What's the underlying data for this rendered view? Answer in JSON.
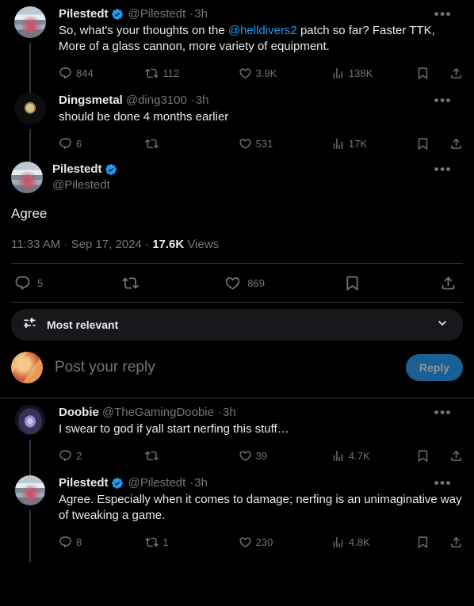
{
  "thread": {
    "posts": [
      {
        "id": "post-1",
        "display_name": "Pilestedt",
        "verified": true,
        "handle": "@Pilestedt",
        "separator": "·",
        "time": "3h",
        "text_before": "So, what's your thoughts on the ",
        "mention": "@helldivers2",
        "text_after": " patch so far? Faster TTK, More of a glass cannon, more variety of equipment.",
        "replies": "844",
        "reposts": "112",
        "likes": "3.9K",
        "views": "138K",
        "avatar_class": "av-pilestedt"
      },
      {
        "id": "post-2",
        "display_name": "Dingsmetal",
        "verified": false,
        "handle": "@ding3100",
        "separator": "·",
        "time": "3h",
        "text": "should be done 4 months earlier",
        "replies": "6",
        "reposts": "",
        "likes": "531",
        "views": "17K",
        "avatar_class": "av-dings"
      }
    ]
  },
  "main_post": {
    "display_name": "Pilestedt",
    "verified": true,
    "handle": "@Pilestedt",
    "text": "Agree",
    "timestamp": "11:33 AM",
    "separator_1": "·",
    "date": "Sep 17, 2024",
    "separator_2": "·",
    "views_count": "17.6K",
    "views_label": "Views",
    "replies": "5",
    "reposts": "",
    "likes": "869",
    "avatar_class": "av-pilestedt"
  },
  "sort": {
    "label": "Most relevant",
    "icon": "sliders-icon",
    "chevron": "chevron-down-icon"
  },
  "composer": {
    "placeholder": "Post your reply",
    "reply_button": "Reply",
    "avatar_class": "av-me"
  },
  "replies": [
    {
      "id": "reply-1",
      "display_name": "Doobie",
      "verified": false,
      "handle": "@TheGamingDoobie",
      "separator": "·",
      "time": "3h",
      "text": "I swear to god if yall start nerfing this stuff…",
      "replies": "2",
      "reposts": "",
      "likes": "39",
      "views": "4.7K",
      "avatar_class": "av-doobie"
    },
    {
      "id": "reply-2",
      "display_name": "Pilestedt",
      "verified": true,
      "handle": "@Pilestedt",
      "separator": "·",
      "time": "3h",
      "text": "Agree. Especially when it comes to damage; nerfing is an unimaginative way of tweaking a game.",
      "replies": "8",
      "reposts": "1",
      "likes": "230",
      "views": "4.8K",
      "avatar_class": "av-pilestedt"
    }
  ],
  "icons": {
    "reply": "reply-icon",
    "repost": "repost-icon",
    "like": "like-icon",
    "views": "analytics-icon",
    "bookmark": "bookmark-icon",
    "share": "share-icon",
    "more": "•••"
  },
  "colors": {
    "background": "#000000",
    "text": "#e7e9ea",
    "muted": "#71767b",
    "link": "#1d9bf0",
    "verified_badge": "#1d9bf0",
    "divider": "#2f3336",
    "sort_background": "#16181c",
    "reply_button": "#1a6094"
  }
}
